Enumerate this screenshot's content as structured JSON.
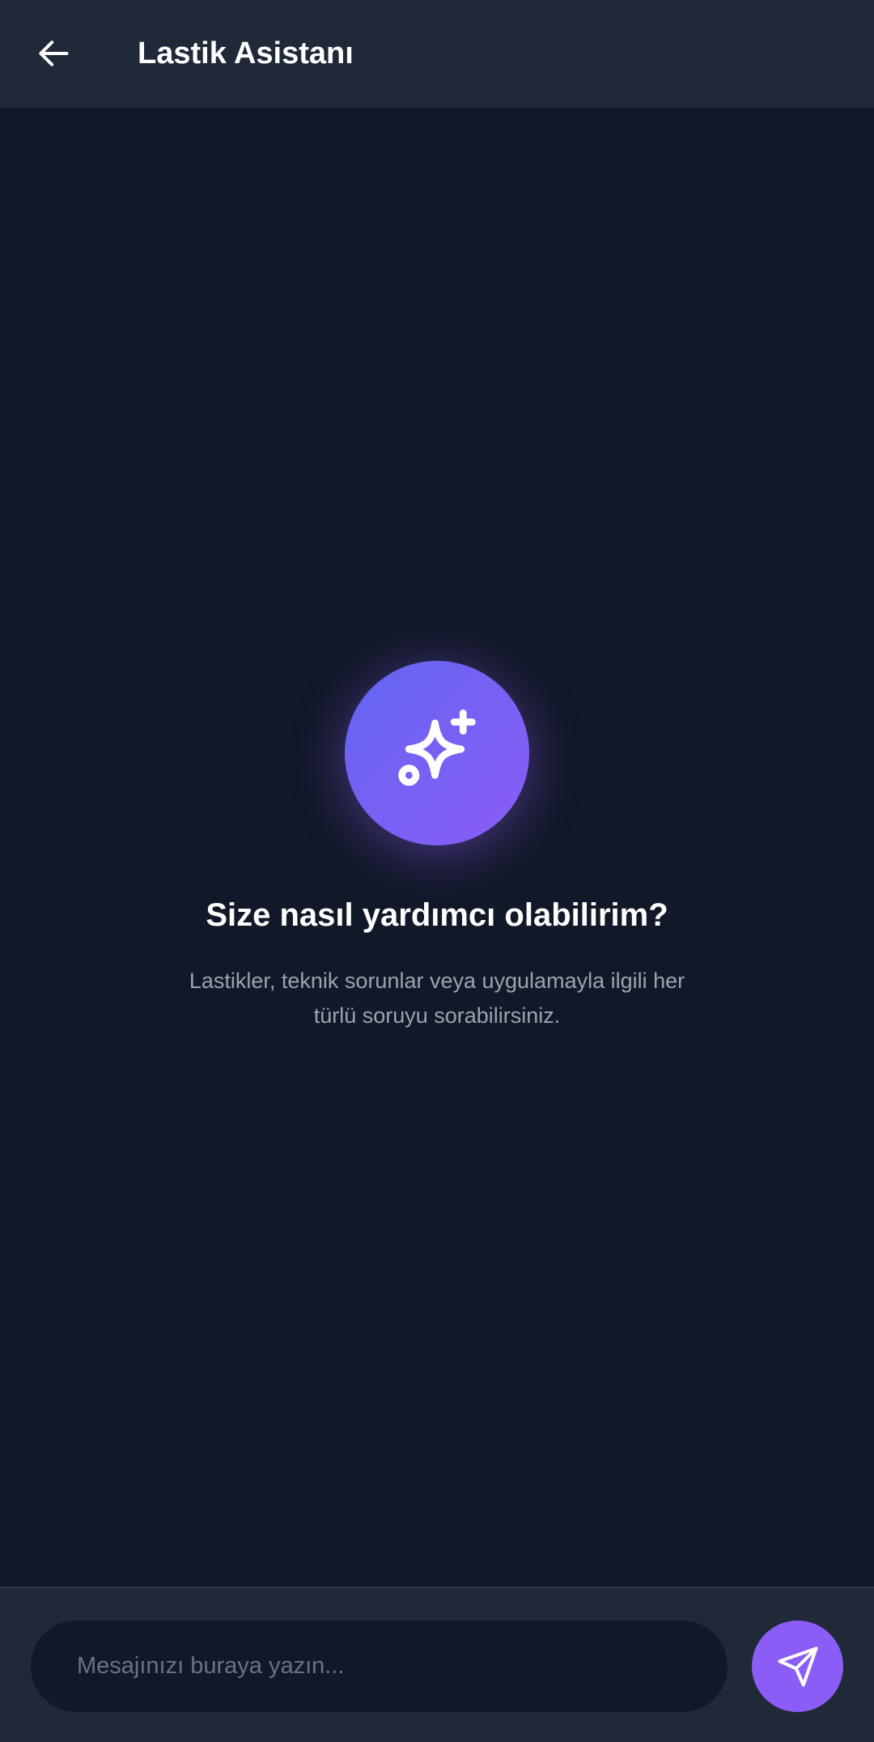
{
  "header": {
    "back_icon": "arrow-left-icon",
    "title": "Lastik Asistanı"
  },
  "empty_state": {
    "icon": "sparkles-icon",
    "headline": "Size nasıl yardımcı olabilirim?",
    "description": "Lastikler, teknik sorunlar veya uygulamayla ilgili her türlü soruyu sorabilirsiniz."
  },
  "composer": {
    "placeholder": "Mesajınızı buraya yazın...",
    "value": "",
    "send_icon": "send-icon"
  },
  "colors": {
    "background": "#111827",
    "surface": "#1f2937",
    "accent": "#8b5cf6",
    "accent_gradient_start": "#6366f1",
    "muted_text": "#9ca3af",
    "placeholder_text": "#6b7280"
  }
}
